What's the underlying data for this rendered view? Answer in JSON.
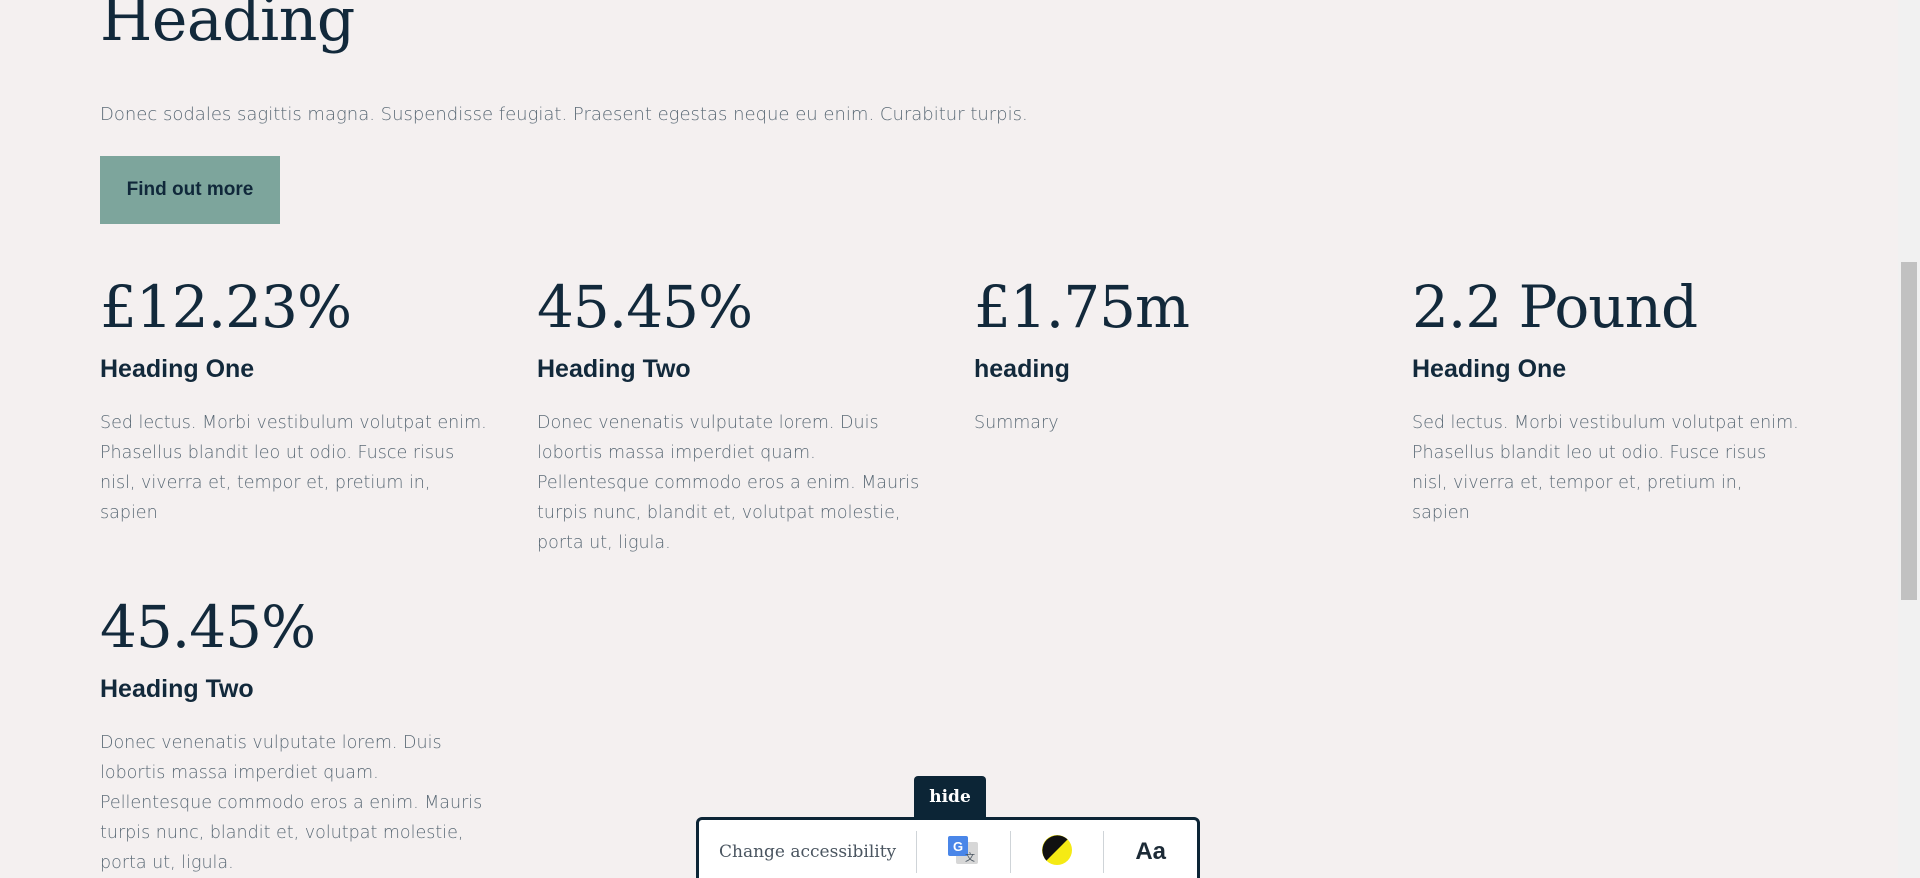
{
  "intro": {
    "heading": "Heading",
    "text": "Donec sodales sagittis magna. Suspendisse feugiat. Praesent egestas neque eu enim. Curabitur turpis.",
    "button_label": "Find out more"
  },
  "stats": [
    {
      "value": "£12.23%",
      "title": "Heading One",
      "text": "Sed lectus. Morbi vestibulum volutpat enim. Phasellus blandit leo ut odio. Fusce risus nisl, viverra et, tempor et, pretium in, sapien"
    },
    {
      "value": "45.45%",
      "title": "Heading Two",
      "text": "Donec venenatis vulputate lorem. Duis lobortis massa imperdiet quam. Pellentesque commodo eros a enim. Mauris turpis nunc, blandit et, volutpat molestie, porta ut, ligula."
    },
    {
      "value": "£1.75m",
      "title": "heading",
      "text": "Summary"
    },
    {
      "value": "2.2 Pound",
      "title": "Heading One",
      "text": "Sed lectus. Morbi vestibulum volutpat enim. Phasellus blandit leo ut odio. Fusce risus nisl, viverra et, tempor et, pretium in, sapien"
    },
    {
      "value": "45.45%",
      "title": "Heading Two",
      "text": "Donec venenatis vulputate lorem. Duis lobortis massa imperdiet quam. Pellentesque commodo eros a enim. Mauris turpis nunc, blandit et, volutpat molestie, porta ut, ligula."
    }
  ],
  "accessibility_widget": {
    "hide_label": "hide",
    "change_label": "Change accessibility",
    "tools": [
      {
        "icon": "google-translate-icon"
      },
      {
        "icon": "contrast-icon"
      },
      {
        "icon": "text-size-icon",
        "glyph": "Aa"
      }
    ]
  },
  "colors": {
    "background": "#f4f0f0",
    "accent_button": "#7da59c",
    "heading_text": "#12293b",
    "body_text": "#5b6a76",
    "widget_dark": "#0c2536"
  }
}
